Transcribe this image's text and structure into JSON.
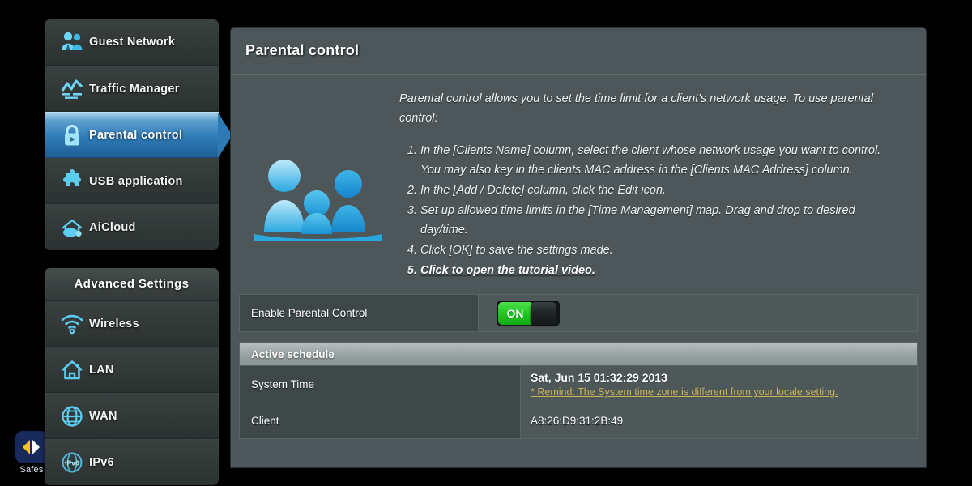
{
  "desktop": {
    "icon": {
      "name": "safes-app-icon",
      "label": "Safes"
    }
  },
  "sidebar": {
    "top_menu": [
      {
        "icon": "guest-network-icon",
        "label": "Guest Network",
        "active": false
      },
      {
        "icon": "traffic-manager-icon",
        "label": "Traffic Manager",
        "active": false
      },
      {
        "icon": "parental-control-lock-icon",
        "label": "Parental control",
        "active": true
      },
      {
        "icon": "usb-application-puzzle-icon",
        "label": "USB application",
        "active": false
      },
      {
        "icon": "aicloud-icon",
        "label": "AiCloud",
        "active": false
      }
    ],
    "advanced": {
      "header": "Advanced Settings",
      "items": [
        {
          "icon": "wireless-wifi-icon",
          "label": "Wireless"
        },
        {
          "icon": "lan-home-icon",
          "label": "LAN"
        },
        {
          "icon": "wan-globe-icon",
          "label": "WAN"
        },
        {
          "icon": "ipv6-globe-icon",
          "label": "IPv6"
        }
      ]
    }
  },
  "panel": {
    "title": "Parental control",
    "intro_lead": "Parental control allows you to set the time limit for a client's network usage. To use parental control:",
    "steps": [
      "In the [Clients Name] column, select the client whose network usage you want to control. You may also key in the clients MAC address in the [Clients MAC Address] column.",
      "In the [Add / Delete] column, click the Edit icon.",
      "Set up allowed time limits in the [Time Management] map. Drag and drop to desired day/time.",
      "Click [OK] to save the settings made."
    ],
    "tutorial_link": "Click to open the tutorial video.",
    "enable_row": {
      "label": "Enable Parental Control",
      "toggle_state": "ON"
    },
    "schedule": {
      "header": "Active schedule",
      "rows": [
        {
          "label": "System Time",
          "value": "Sat, Jun 15  01:32:29  2013",
          "remind": "* Remind: The System time zone is different from your locale setting."
        },
        {
          "label": "Client",
          "value": "A8:26:D9:31:2B:49",
          "remind": ""
        }
      ]
    }
  },
  "colors": {
    "panel_bg": "#4d5759",
    "sidebar_bg": "#333938",
    "accent_blue": "#2f7cb8",
    "icon_cyan": "#5cc8f0",
    "toggle_green": "#1fc81f",
    "remind_gold": "#c9b45a"
  }
}
